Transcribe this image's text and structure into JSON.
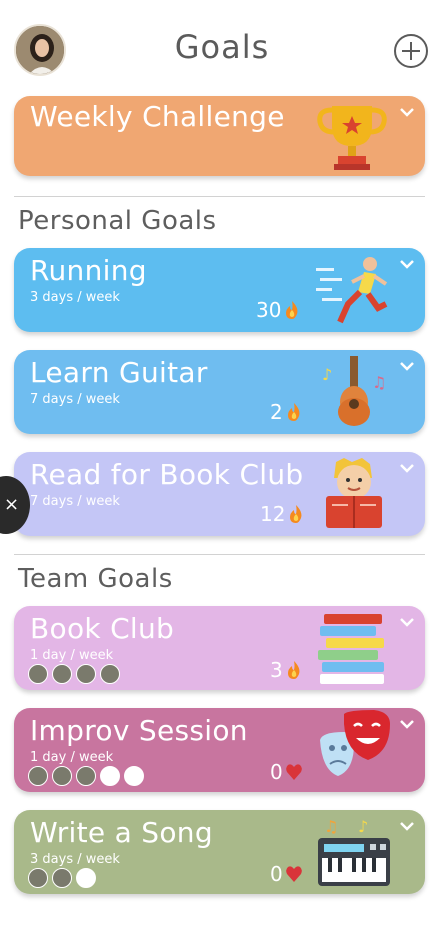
{
  "header": {
    "title": "Goals",
    "avatar_icon": "user-avatar",
    "add_icon": "plus-circle-icon"
  },
  "featured": {
    "title": "Weekly Challenge",
    "color": "#f0a772",
    "icon": "trophy-icon"
  },
  "sections": {
    "personal": "Personal Goals",
    "team": "Team Goals"
  },
  "personal_goals": [
    {
      "title": "Running",
      "frequency": "3 days / week",
      "streak": "30",
      "streak_icon": "flame-icon",
      "color": "#5dbdf0",
      "art": "runner-illustration"
    },
    {
      "title": "Learn Guitar",
      "frequency": "7 days / week",
      "streak": "2",
      "streak_icon": "flame-icon",
      "color": "#6fbdf0",
      "art": "guitar-illustration"
    },
    {
      "title": "Read for Book Club",
      "frequency": "7 days / week",
      "streak": "12",
      "streak_icon": "flame-icon",
      "color": "#c4c6f6",
      "art": "reading-child-illustration"
    }
  ],
  "team_goals": [
    {
      "title": "Book Club",
      "frequency": "1 day / week",
      "streak": "3",
      "streak_icon": "flame-icon",
      "color": "#e3b6e6",
      "art": "book-stack-illustration"
    },
    {
      "title": "Improv Session",
      "frequency": "1 day / week",
      "streak": "0",
      "streak_icon": "heart-icon",
      "color": "#c8759f",
      "art": "theater-masks-illustration"
    },
    {
      "title": "Write a Song",
      "frequency": "3 days / week",
      "streak": "0",
      "streak_icon": "heart-icon",
      "color": "#a9b98a",
      "art": "keyboard-illustration"
    }
  ],
  "overlay": {
    "close_label": "×"
  }
}
